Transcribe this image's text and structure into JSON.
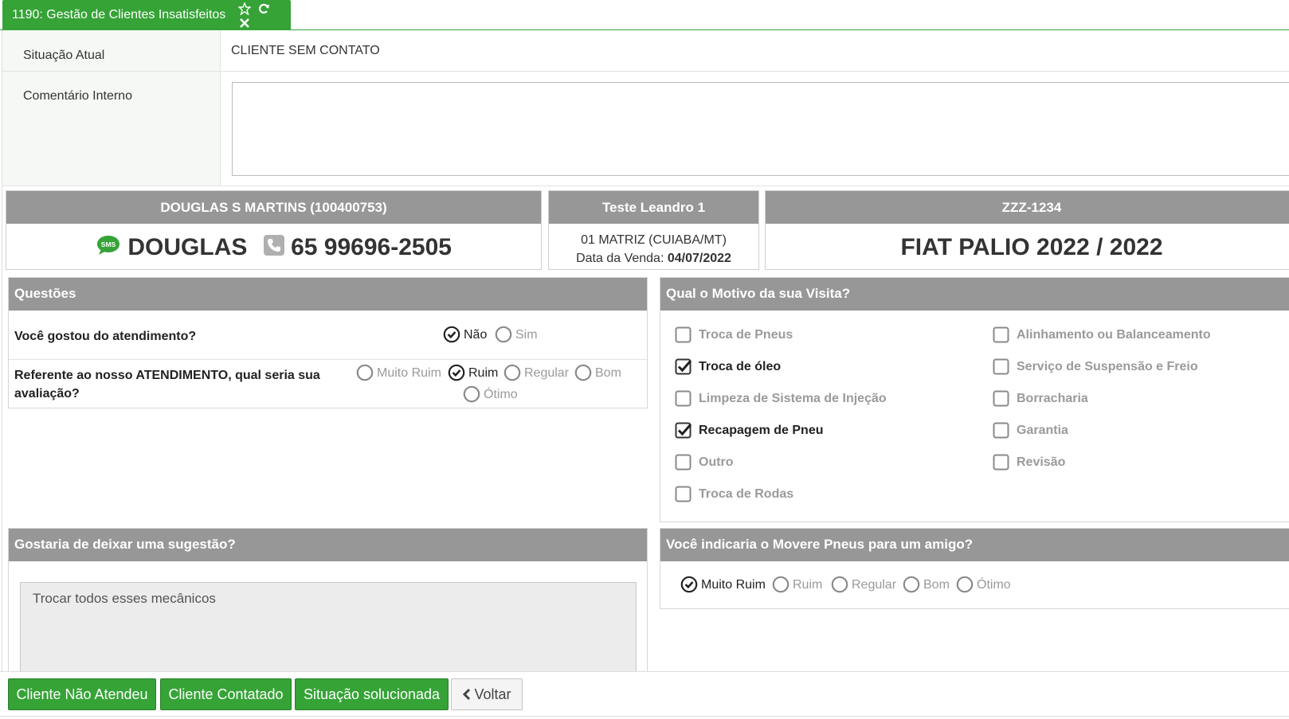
{
  "tab": {
    "title": "1190: Gestão de Clientes Insatisfeitos",
    "icons": [
      "star-icon",
      "refresh-icon",
      "close-icon"
    ]
  },
  "form": {
    "situacao_label": "Situação Atual",
    "situacao_value": "CLIENTE SEM CONTATO",
    "comentario_label": "Comentário Interno",
    "comentario_value": ""
  },
  "customer": {
    "header": "DOUGLAS S MARTINS (100400753)",
    "name": "DOUGLAS",
    "phone": "65 99696-2505",
    "sms_badge": "SMS"
  },
  "seller": {
    "header": "Teste Leandro 1",
    "store": "01 MATRIZ (CUIABA/MT)",
    "sale_date_label": "Data da Venda:",
    "sale_date": "04/07/2022"
  },
  "vehicle": {
    "header": "ZZZ-1234",
    "model": "FIAT PALIO",
    "year": "2022 / 2022"
  },
  "questoes": {
    "title": "Questões",
    "q1": {
      "text": "Você gostou do atendimento?",
      "options": [
        "Não",
        "Sim"
      ],
      "selected": "Não"
    },
    "q2": {
      "text": "Referente ao nosso ATENDIMENTO, qual seria sua avaliação?",
      "options": [
        "Muito Ruim",
        "Ruim",
        "Regular",
        "Bom",
        "Ótimo"
      ],
      "selected": "Ruim"
    }
  },
  "motivo": {
    "title": "Qual o Motivo da sua Visita?",
    "items": [
      {
        "label": "Troca de Pneus",
        "checked": false
      },
      {
        "label": "Alinhamento ou Balanceamento",
        "checked": false
      },
      {
        "label": "Troca de óleo",
        "checked": true
      },
      {
        "label": "Serviço de Suspensão e Freio",
        "checked": false
      },
      {
        "label": "Limpeza de Sistema de Injeção",
        "checked": false
      },
      {
        "label": "Borracharia",
        "checked": false
      },
      {
        "label": "Recapagem de Pneu",
        "checked": true
      },
      {
        "label": "Garantia",
        "checked": false
      },
      {
        "label": "Outro",
        "checked": false
      },
      {
        "label": "Revisão",
        "checked": false
      },
      {
        "label": "Troca de Rodas",
        "checked": false
      }
    ]
  },
  "sugestao": {
    "title": "Gostaria de deixar uma sugestão?",
    "value": "Trocar todos esses mecânicos"
  },
  "indicaria": {
    "title": "Você indicaria o Movere Pneus para um amigo?",
    "options": [
      "Muito Ruim",
      "Ruim",
      "Regular",
      "Bom",
      "Ótimo"
    ],
    "selected": "Muito Ruim"
  },
  "footer": {
    "btn_nao_atendeu": "Cliente Não Atendeu",
    "btn_contatado": "Cliente Contatado",
    "btn_solucionada": "Situação solucionada",
    "btn_voltar": "Voltar"
  },
  "colors": {
    "accent_green": "#35a336",
    "header_gray": "#979797"
  }
}
